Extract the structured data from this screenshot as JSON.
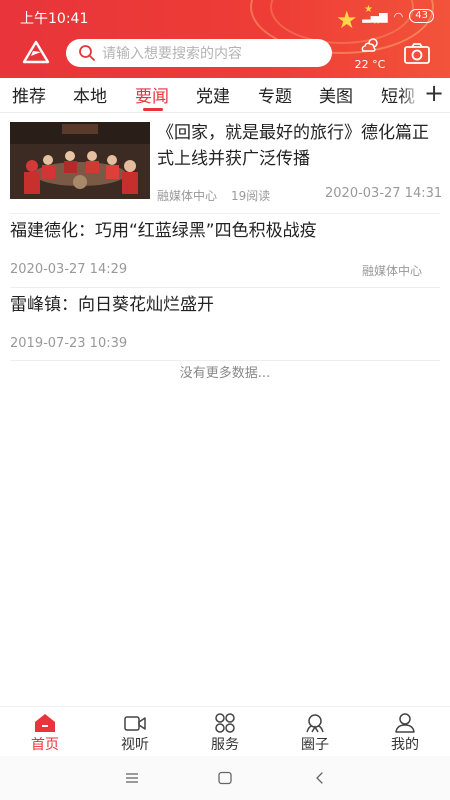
{
  "status_bar": {
    "time": "上午10:41",
    "battery": "43"
  },
  "header": {
    "search_placeholder": "请输入想要搜索的内容",
    "weather_temp": "22 °C",
    "icons": [
      "app-logo-icon",
      "search-icon",
      "weather-icon",
      "camera-icon"
    ]
  },
  "tabs": [
    {
      "label": "推荐"
    },
    {
      "label": "本地"
    },
    {
      "label": "要闻",
      "active": true
    },
    {
      "label": "党建"
    },
    {
      "label": "专题"
    },
    {
      "label": "美图"
    },
    {
      "label": "短视"
    }
  ],
  "tab_add": "+",
  "news": [
    {
      "title": "《回家，就是最好的旅行》德化篇正式上线并获广泛传播",
      "source": "融媒体中心",
      "reads": "19阅读",
      "time": "2020-03-27 14:31",
      "has_image": true
    },
    {
      "title": "福建德化：巧用“红蓝绿黑”四色积极战疫",
      "source": "融媒体中心",
      "time": "2020-03-27 14:29"
    },
    {
      "title": "雷峰镇：向日葵花灿烂盛开",
      "time": "2019-07-23 10:39"
    }
  ],
  "no_more": "没有更多数据...",
  "bottom_nav": [
    {
      "label": "首页",
      "icon": "home-icon",
      "active": true
    },
    {
      "label": "视听",
      "icon": "video-icon"
    },
    {
      "label": "服务",
      "icon": "services-icon"
    },
    {
      "label": "圈子",
      "icon": "circle-icon"
    },
    {
      "label": "我的",
      "icon": "profile-icon"
    }
  ],
  "colors": {
    "brand_red": "#e8343a",
    "text": "#222222",
    "meta": "#999999"
  }
}
